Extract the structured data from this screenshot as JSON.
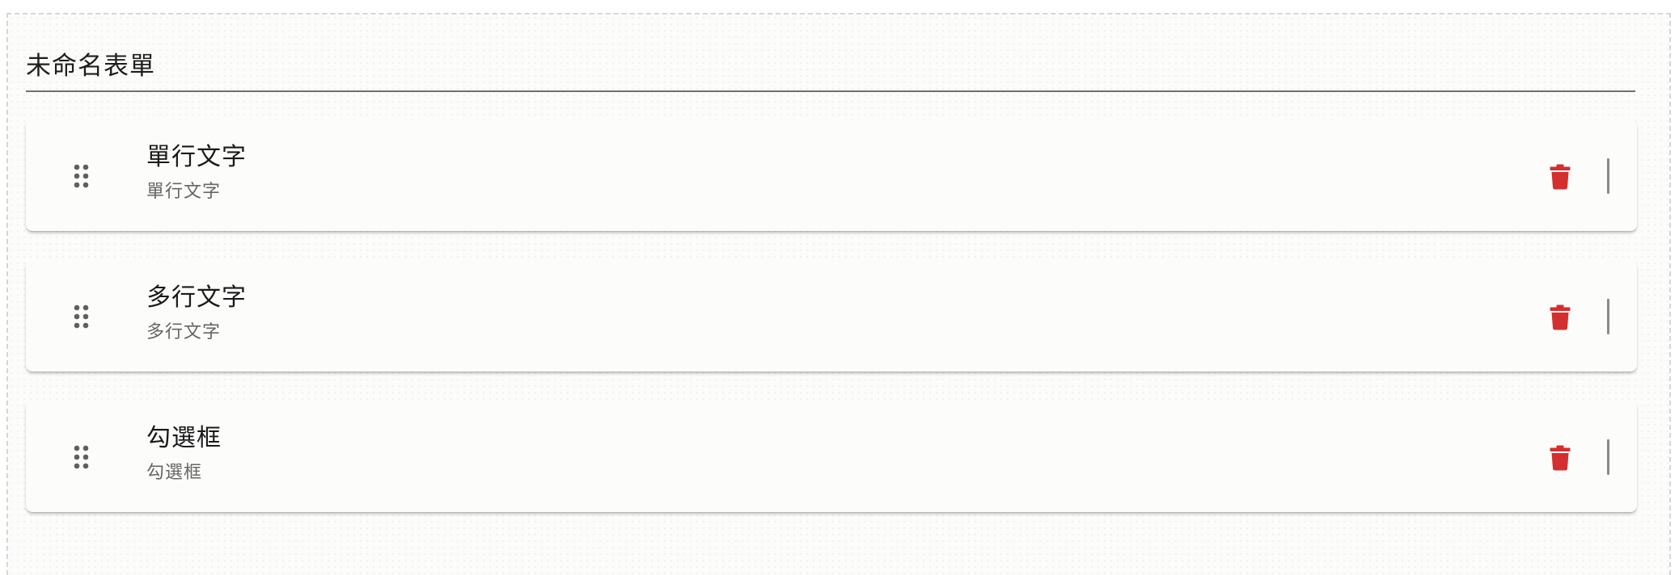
{
  "form": {
    "title": "未命名表單"
  },
  "fields": [
    {
      "title": "單行文字",
      "subtitle": "單行文字"
    },
    {
      "title": "多行文字",
      "subtitle": "多行文字"
    },
    {
      "title": "勾選框",
      "subtitle": "勾選框"
    }
  ],
  "icons": {
    "drag": "drag-handle-icon",
    "delete": "trash-icon"
  },
  "colors": {
    "delete": "#d32f2f",
    "handle": "#5f5f5f",
    "divider": "#6f6f6f"
  }
}
